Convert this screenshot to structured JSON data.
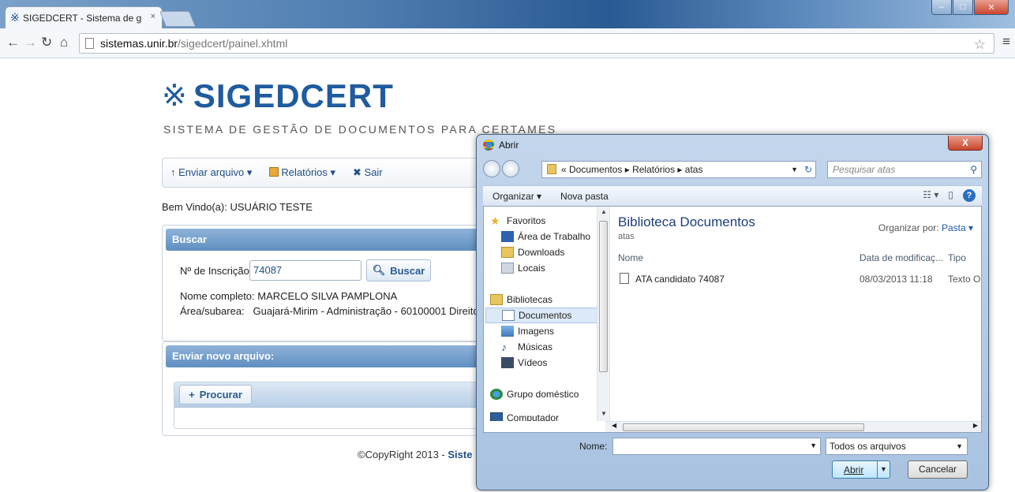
{
  "browser": {
    "tab_title": "SIGEDCERT - Sistema de g",
    "tab_close": "×",
    "url_host": "sistemas.unir.br",
    "url_path": "/sigedcert/painel.xhtml"
  },
  "page": {
    "logo_text": "SIGEDCERT",
    "subtitle": "SISTEMA DE GESTÃO DE DOCUMENTOS PARA CERTAMES",
    "menu": {
      "enviar": "↑ Enviar arquivo ▾",
      "relatorios": "Relatórios ▾",
      "sair": "✖ Sair"
    },
    "welcome": "Bem Vindo(a): USUÁRIO TESTE",
    "buscar_panel": {
      "title": "Buscar",
      "label_inscricao": "Nº de Inscrição:",
      "inscricao_value": "74087",
      "button_label": "Buscar",
      "nome_line": "Nome completo: MARCELO SILVA PAMPLONA",
      "area_line": "Área/subarea:   Guajará-Mirim - Administração - 60100001 Direito"
    },
    "enviar_panel": {
      "title": "Enviar novo arquivo:",
      "procurar_label": "Procurar"
    },
    "copyright_prefix": "©CopyRight 2013 - ",
    "copyright_bold": "Siste"
  },
  "dialog": {
    "title": "Abrir",
    "close": "X",
    "address": "« Documentos ▸ Relatórios ▸ atas",
    "search_placeholder": "Pesquisar atas",
    "cmd_organizar": "Organizar ▾",
    "cmd_nova_pasta": "Nova pasta",
    "nav": [
      "Favoritos",
      "Área de Trabalho",
      "Downloads",
      "Locais",
      "Bibliotecas",
      "Documentos",
      "Imagens",
      "Músicas",
      "Vídeos",
      "Grupo doméstico",
      "Computador"
    ],
    "library_title": "Biblioteca Documentos",
    "library_sub": "atas",
    "organize_by_label": "Organizar por:",
    "organize_by_value": "Pasta ▾",
    "columns": {
      "nome": "Nome",
      "data": "Data de modificaç...",
      "tipo": "Tipo"
    },
    "file": {
      "name": "ATA candidato 74087",
      "date": "08/03/2013 11:18",
      "type": "Texto O"
    },
    "name_label": "Nome:",
    "file_type": "Todos os arquivos",
    "open_label": "Abrir",
    "cancel_label": "Cancelar"
  },
  "colors": {
    "brand_blue": "#1f5b9e",
    "panel_header": "#6f9bcb"
  }
}
